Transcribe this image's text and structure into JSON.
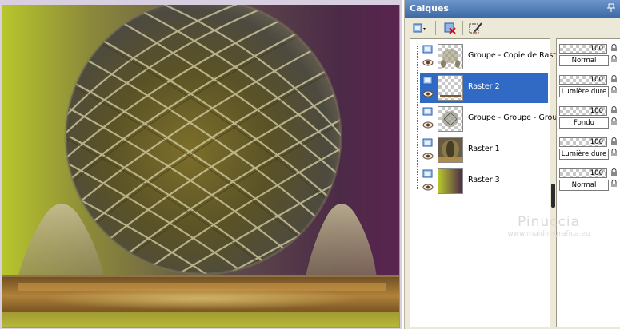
{
  "palette": {
    "title": "Calques",
    "icons": {
      "pin": "pin-icon",
      "new_layer": "new-layer-icon",
      "delete_layer": "delete-layer-icon",
      "edit_selection": "edit-selection-icon"
    }
  },
  "layers": [
    {
      "name": "Groupe - Copie de Raster",
      "selected": false,
      "thumb": "checker-pattern",
      "opacity": "100",
      "blend": "Normal"
    },
    {
      "name": "Raster 2",
      "selected": true,
      "thumb": "checker-blank",
      "opacity": "100",
      "blend": "Lumière dure"
    },
    {
      "name": "Groupe - Groupe - Groupe",
      "selected": false,
      "thumb": "checker-dots",
      "opacity": "100",
      "blend": "Fondu"
    },
    {
      "name": "Raster 1",
      "selected": false,
      "thumb": "sphere",
      "opacity": "100",
      "blend": "Lumière dure"
    },
    {
      "name": "Raster 3",
      "selected": false,
      "thumb": "gradient",
      "opacity": "100",
      "blend": "Normal"
    }
  ],
  "watermark": {
    "name": "Pinuccia",
    "url": "www.maidiregrafica.eu"
  },
  "colors": {
    "selection": "#316ac5",
    "title_bar": "#3d6aa7",
    "art_lime": "#b5c42a",
    "art_purple": "#4d2a45"
  }
}
